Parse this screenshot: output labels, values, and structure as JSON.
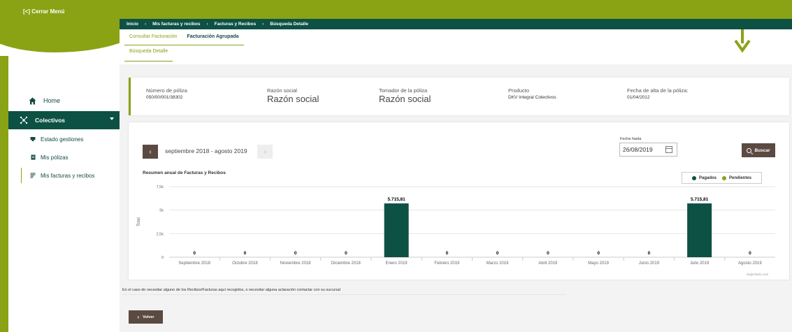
{
  "sidebar": {
    "close_label": "[<] Cerrar Menú",
    "home": "Home",
    "colectivos": "Colectivos",
    "items": [
      {
        "label": "Estado gestiones"
      },
      {
        "label": "Mis pólizas"
      },
      {
        "label": "Mis facturas y recibos"
      }
    ]
  },
  "breadcrumb": [
    "Inicio",
    "Mis facturas y recibos",
    "Facturas y Recibos",
    "Búsqueda Detalle"
  ],
  "tabs": [
    {
      "label": "Consultar Facturación"
    },
    {
      "label": "Facturación Agrupada"
    }
  ],
  "subtab": "Búsqueda Detalle",
  "policy": {
    "numero_label": "Número de póliza",
    "numero_value": "050/00/001/38302",
    "razon_label": "Razón social",
    "razon_value": "Razón social",
    "tomador_label": "Tomador de la póliza",
    "tomador_value": "Razón social",
    "producto_label": "Producto",
    "producto_value": "DKV Integral Colectivos",
    "fecha_alta_label": "Fecha de alta de la póliza:",
    "fecha_alta_value": "01/04/2012"
  },
  "period": {
    "label": "septiembre 2018 - agosto 2019",
    "prev": "‹",
    "next": "›"
  },
  "date_filter": {
    "label": "Fecha hasta",
    "value": "26/08/2019"
  },
  "search_label": "Buscar",
  "chart_data": {
    "type": "bar",
    "title": "Resumen anual de Facturas y Recibos",
    "ylabel": "Total",
    "ylim": [
      0,
      7500
    ],
    "yticks": [
      "0",
      "2,5k",
      "5k",
      "7,5k"
    ],
    "ytick_values": [
      0,
      2500,
      5000,
      7500
    ],
    "categories": [
      "Septiembre 2018",
      "Octubre 2018",
      "Noviembre 2018",
      "Diciembre 2018",
      "Enero 2019",
      "Febrero 2019",
      "Marzo 2019",
      "Abril 2019",
      "Mayo 2019",
      "Junio 2019",
      "Julio 2019",
      "Agosto 2019"
    ],
    "series": [
      {
        "name": "Pagados",
        "color": "#0d5145",
        "values": [
          0,
          0,
          0,
          0,
          5715.81,
          0,
          0,
          0,
          0,
          0,
          5715.81,
          0
        ]
      },
      {
        "name": "Pendientes",
        "color": "#8aa315",
        "values": [
          0,
          0,
          0,
          0,
          0,
          0,
          0,
          0,
          0,
          0,
          0,
          0
        ]
      }
    ],
    "data_labels": [
      "0",
      "0",
      "0",
      "0",
      "5.715,81",
      "0",
      "0",
      "0",
      "0",
      "0",
      "5.715,81",
      "0"
    ],
    "grid": true,
    "legend_position": "top-right",
    "credits": "Highcharts.com"
  },
  "note": "En el caso de necesitar alguno de los Recibos/Facturas aquí recogidos, o necesitar alguna aclaración contactar con su sucursal",
  "back_label": "Volver",
  "colors": {
    "brand_green": "#8aa315",
    "dark_teal": "#0d5145",
    "button_brown": "#5a4a42"
  }
}
